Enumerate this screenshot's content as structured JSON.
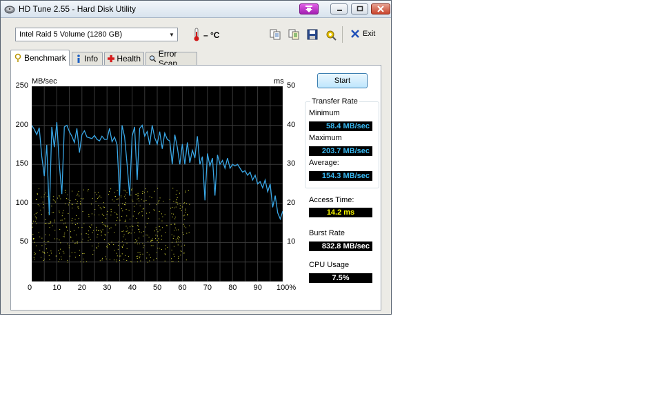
{
  "window": {
    "title": "HD Tune 2.55 - Hard Disk Utility"
  },
  "toolbar": {
    "drive": "Intel   Raid 5 Volume (1280 GB)",
    "temperature": "– °C",
    "exit_label": "Exit",
    "icons": [
      "copy-text-icon",
      "copy-info-icon",
      "save-icon",
      "options-icon",
      "exit-icon"
    ]
  },
  "tabs": [
    {
      "label": "Benchmark",
      "icon": "benchmark-icon",
      "active": true
    },
    {
      "label": "Info",
      "icon": "info-icon",
      "active": false
    },
    {
      "label": "Health",
      "icon": "health-icon",
      "active": false
    },
    {
      "label": "Error Scan",
      "icon": "error-scan-icon",
      "active": false
    }
  ],
  "benchmark": {
    "start_label": "Start",
    "transfer_rate_title": "Transfer Rate",
    "minimum_label": "Minimum",
    "minimum_value": "58.4 MB/sec",
    "maximum_label": "Maximum",
    "maximum_value": "203.7 MB/sec",
    "average_label": "Average:",
    "average_value": "154.3 MB/sec",
    "access_label": "Access Time:",
    "access_value": "14.2 ms",
    "burst_label": "Burst Rate",
    "burst_value": "832.8 MB/sec",
    "cpu_label": "CPU Usage",
    "cpu_value": "7.5%"
  },
  "colors": {
    "plot_background": "#000000",
    "grid": "#3a3a3a",
    "transfer_line": "#39a7e6",
    "access_points": "#e6e63a",
    "access_value_text": "#ffff00",
    "stat_value_text": "#39b7ef"
  },
  "chart_data": {
    "type": "line",
    "ylabel_left": "MB/sec",
    "ylabel_right": "ms",
    "y_left_ticks": [
      "250",
      "200",
      "150",
      "100",
      "50"
    ],
    "y_right_ticks": [
      "50",
      "40",
      "30",
      "20",
      "10"
    ],
    "x_ticks": [
      "0",
      "10",
      "20",
      "30",
      "40",
      "50",
      "60",
      "70",
      "80",
      "90",
      "100%"
    ],
    "xlim": [
      0,
      100
    ],
    "ylim_left": [
      0,
      250
    ],
    "ylim_right": [
      0,
      50
    ],
    "grid": true,
    "series": [
      {
        "x": [
          0,
          1,
          2,
          3,
          4,
          5,
          6,
          7,
          8,
          9,
          10,
          11,
          12,
          13,
          14,
          15,
          16,
          17,
          18,
          19,
          20,
          21,
          22,
          23,
          24,
          25,
          26,
          27,
          28,
          29,
          30,
          31,
          32,
          33,
          34,
          35,
          36,
          37,
          38,
          39,
          40,
          41,
          42,
          43,
          44,
          45,
          46,
          47,
          48,
          49,
          50,
          51,
          52,
          53,
          54,
          55,
          56,
          57,
          58,
          59,
          60,
          61,
          62,
          63,
          64,
          65,
          66,
          67,
          68,
          69,
          70,
          71,
          72,
          73,
          74,
          75,
          76,
          77,
          78,
          79,
          80,
          81,
          82,
          83,
          84,
          85,
          86,
          87,
          88,
          89,
          90,
          91,
          92,
          93,
          94,
          95,
          96,
          97,
          98,
          99,
          100
        ],
        "values": [
          200,
          195,
          188,
          197,
          160,
          135,
          175,
          85,
          198,
          172,
          204,
          150,
          112,
          198,
          200,
          192,
          186,
          178,
          196,
          165,
          188,
          193,
          185,
          184,
          183,
          187,
          182,
          180,
          186,
          182,
          182,
          196,
          179,
          185,
          175,
          110,
          200,
          185,
          150,
          110,
          186,
          198,
          130,
          196,
          200,
          186,
          192,
          175,
          200,
          184,
          176,
          192,
          170,
          190,
          182,
          180,
          150,
          188,
          172,
          150,
          176,
          150,
          178,
          152,
          168,
          158,
          186,
          150,
          160,
          104,
          164,
          148,
          158,
          110,
          162,
          150,
          155,
          145,
          158,
          145,
          150,
          148,
          150,
          145,
          140,
          142,
          136,
          140,
          130,
          136,
          125,
          128,
          120,
          130,
          115,
          125,
          95,
          110,
          88,
          80,
          90
        ]
      }
    ],
    "access_time_scatter": {
      "x_range": [
        0,
        63
      ],
      "y_range_ms": [
        5,
        24
      ],
      "point_count": 600
    }
  }
}
